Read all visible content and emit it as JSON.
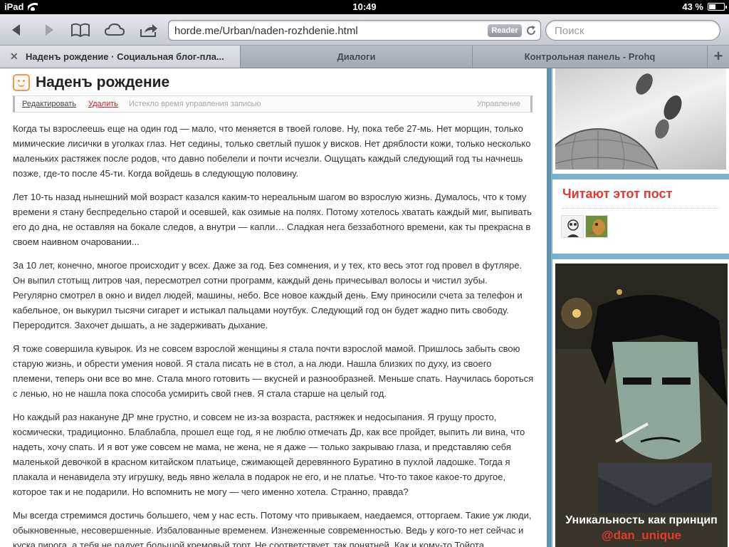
{
  "status_bar": {
    "device": "iPad",
    "time": "10:49",
    "battery_text": "43 %",
    "battery_level": 0.43
  },
  "toolbar": {
    "url": "horde.me/Urban/naden-rozhdenie.html",
    "reader_label": "Reader",
    "search_placeholder": "Поиск"
  },
  "tabs": [
    {
      "label": "Наденъ рождение · Социальная блог-пла...",
      "active": true
    },
    {
      "label": "Диалоги",
      "active": false
    },
    {
      "label": "Контрольная панель - Prohq",
      "active": false
    }
  ],
  "post": {
    "title": "Наденъ рождение",
    "actions": {
      "edit": "Редактировать",
      "delete": "Удалить",
      "expired": "Истекло время управления записью",
      "manage": "Управление"
    },
    "paragraphs": [
      "Когда ты взрослеешь еще на один год — мало, что меняется в твоей голове. Ну, пока тебе 27-мь. Нет морщин, только мимические лисички в уголках глаз. Нет седины, только светлый пушок у висков. Нет дряблости кожи, только несколько маленьких растяжек после родов, что давно побелели и почти исчезли. Ощущать каждый следующий год ты начнешь позже, где-то после 45-ти. Когда войдешь в следующую половину.",
      "Лет 10-ть назад нынешний мой возраст казался каким-то нереальным шагом во взрослую жизнь. Думалось, что к тому времени я стану беспредельно старой и осевшей, как озимые на полях. Потому хотелось хватать каждый миг, выпивать его до дна, не оставляя на бокале следов, а внутри — капли… Сладкая нега беззаботного времени, как ты прекрасна в своем наивном очаровании...",
      "За 10 лет, конечно, многое происходит у всех. Даже за год. Без сомнения, и у тех, кто весь этот год провел в футляре. Он выпил стотыщ литров чая, пересмотрел сотни программ, каждый день причесывал волосы и чистил зубы. Регулярно смотрел в окно и видел людей, машины, небо. Все новое каждый день. Ему приносили счета за телефон и кабельное, он выкурил тысячи сигарет и истыкал пальцами ноутбук. Следующий год он будет жадно пить свободу. Переродится. Захочет дышать, а не задерживать дыхание.",
      "Я тоже совершила кувырок. Из не совсем взрослой женщины я стала почти взрослой мамой. Пришлось забыть свою старую жизнь, и обрести умения новой. Я стала писать не в стол, а на люди. Нашла близких по духу, из своего племени, теперь они все во мне. Стала много готовить — вкусней и разнообразней. Меньше спать. Научилась бороться с ленью, но не нашла пока способа усмирить свой гнев. Я стала старше на целый год.",
      "Но каждый раз накануне ДР мне грустно, и совсем не из-за возраста, растяжек и недосыпания. Я грущу просто, космически, традиционно. Блаблабла, прошел еще год, я не люблю отмечать Др, как все пройдет, выпить ли вина, что надеть, хочу спать. И я вот уже совсем не мама, не жена, не я даже — только закрываю глаза, и представляю себя маленькой девочкой в красном китайском платьице, сжимающей деревянного Буратино в пухлой ладошке. Тогда я плакала и ненавидела эту игрушку, ведь явно желала в подарок не его, и не платье. Что-то такое какое-то другое, которое так и не подарили. Но вспомнить не могу — чего именно хотела. Странно, правда?",
      "Мы всегда стремимся достичь большего, чем у нас есть. Потому что привыкаем, наедаемся, отторгаем. Такие уж люди, обыкновенные, несовершенные. Избалованные временем. Изнеженные современностью. Ведь у кого-то нет сейчас и куска пирога, а тебя не радует большой кремовый торт. Не соответствует, так понятней. Как и кому-то Тойота"
    ]
  },
  "sidebar": {
    "readers_title": "Читают этот пост",
    "promo_line1": "Уникальность как принцип",
    "promo_line2": "@dan_unique"
  },
  "colors": {
    "accent_red": "#e23a2e",
    "sidebar_bg": "#7bb2cc",
    "post_icon": "#e89a5b"
  }
}
